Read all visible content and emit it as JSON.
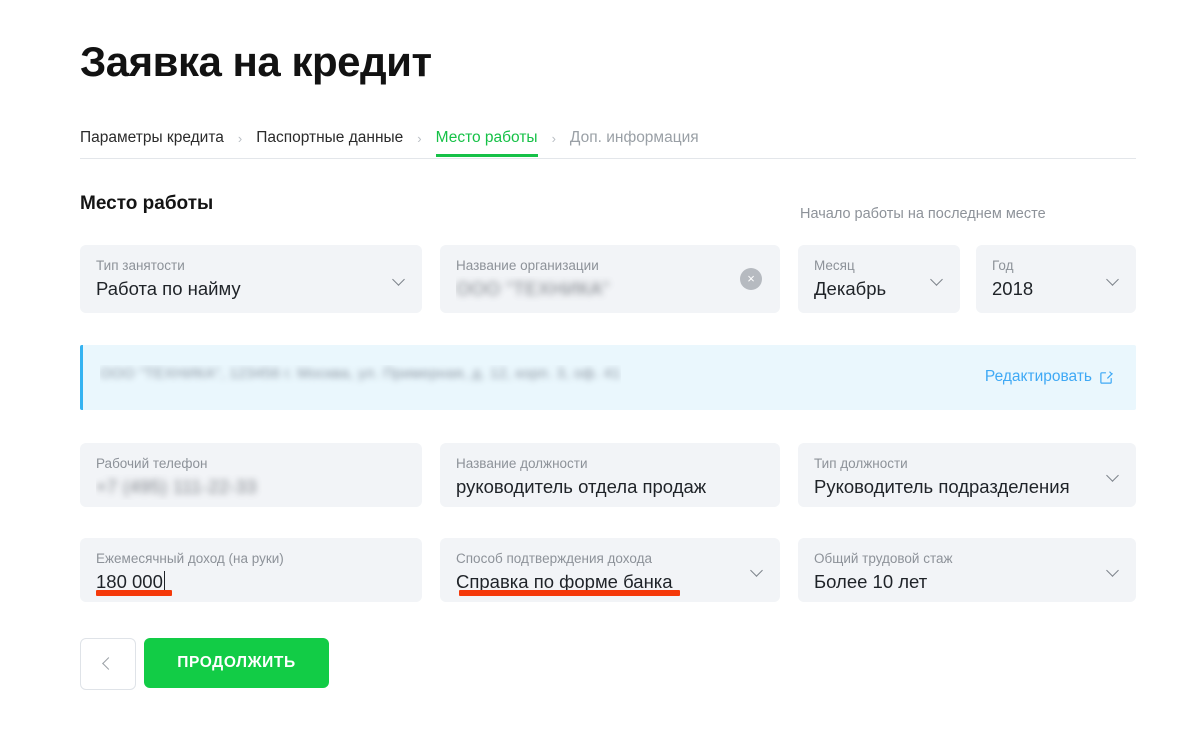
{
  "page": {
    "title": "Заявка на кредит"
  },
  "steps": {
    "separator": "›",
    "items": [
      {
        "label": "Параметры кредита",
        "state": "done"
      },
      {
        "label": "Паспортные данные",
        "state": "done"
      },
      {
        "label": "Место работы",
        "state": "active"
      },
      {
        "label": "Доп. информация",
        "state": "future"
      }
    ]
  },
  "section": {
    "title": "Место работы",
    "group_caption": "Начало работы на последнем месте"
  },
  "fields": {
    "employment_type": {
      "label": "Тип занятости",
      "value": "Работа по найму"
    },
    "organization_name": {
      "label": "Название организации",
      "value": "ООО \"ТЕХНИКА\"",
      "redacted": true,
      "clear_icon": "×"
    },
    "start_month": {
      "label": "Месяц",
      "value": "Декабрь"
    },
    "start_year": {
      "label": "Год",
      "value": "2018"
    },
    "work_phone": {
      "label": "Рабочий телефон",
      "value": "+7 (495) 111-22-33",
      "redacted": true
    },
    "position_name": {
      "label": "Название должности",
      "value": "руководитель отдела продаж"
    },
    "position_type": {
      "label": "Тип должности",
      "value": "Руководитель подразделения"
    },
    "monthly_income": {
      "label": "Ежемесячный доход (на руки)",
      "value": "180 000"
    },
    "income_proof": {
      "label": "Способ подтверждения дохода",
      "value": "Справка по форме банка"
    },
    "total_experience": {
      "label": "Общий трудовой стаж",
      "value": "Более 10 лет"
    }
  },
  "banner": {
    "text": "ООО \"ТЕХНИКА\", 123456 г. Москва, ул. Примерная, д. 12, корп. 3, оф. 41",
    "redacted": true,
    "edit_label": "Редактировать",
    "edit_icon": "edit-square-icon",
    "accent_color": "#35b3f1",
    "background_color": "#eaf7fd"
  },
  "annotations": {
    "highlight_color": "#f5390a",
    "underlines": [
      "monthly_income",
      "income_proof"
    ]
  },
  "buttons": {
    "back_label": "",
    "back_icon": "chevron-left-icon",
    "continue_label": "ПРОДОЛЖИТЬ",
    "continue_color": "#12cc46"
  }
}
